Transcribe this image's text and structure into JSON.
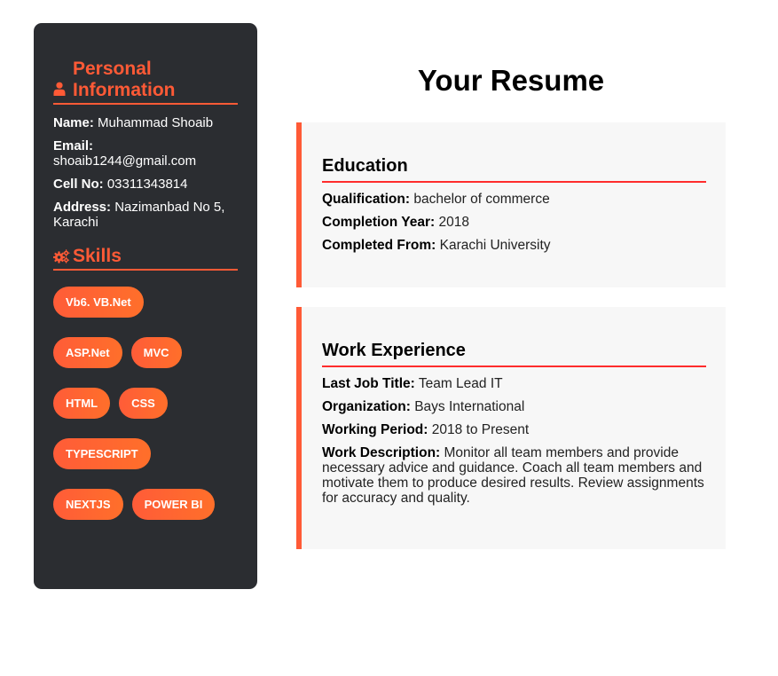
{
  "personal": {
    "heading": "Personal Information",
    "fields": [
      {
        "label": "Name:",
        "value": "Muhammad Shoaib"
      },
      {
        "label": "Email:",
        "value": "shoaib1244@gmail.com"
      },
      {
        "label": "Cell No:",
        "value": "03311343814"
      },
      {
        "label": "Address:",
        "value": "Nazimanbad No 5, Karachi"
      }
    ]
  },
  "skills": {
    "heading": "Skills",
    "items": [
      "Vb6. VB.Net",
      "ASP.Net",
      "MVC",
      "HTML",
      "CSS",
      "TYPESCRIPT",
      "NEXTJS",
      "POWER BI"
    ]
  },
  "main": {
    "title": "Your Resume",
    "education": {
      "heading": "Education",
      "fields": [
        {
          "label": "Qualification:",
          "value": "bachelor of commerce"
        },
        {
          "label": "Completion Year:",
          "value": "2018"
        },
        {
          "label": "Completed From:",
          "value": "Karachi University"
        }
      ]
    },
    "work": {
      "heading": "Work Experience",
      "fields": [
        {
          "label": "Last Job Title:",
          "value": "Team Lead IT"
        },
        {
          "label": "Organization:",
          "value": "Bays International"
        },
        {
          "label": "Working Period:",
          "value": "2018 to Present"
        },
        {
          "label": "Work Description:",
          "value": "Monitor all team members and provide necessary advice and guidance. Coach all team members and motivate them to produce desired results. Review assignments for accuracy and quality."
        }
      ]
    }
  },
  "icons": {
    "personal": "user-icon",
    "skills": "gears-icon"
  },
  "colors": {
    "accent": "#ff5a36",
    "sidebar_bg": "#2b2d31",
    "card_bg": "#f7f7f7",
    "underline": "#ff2c2c"
  }
}
